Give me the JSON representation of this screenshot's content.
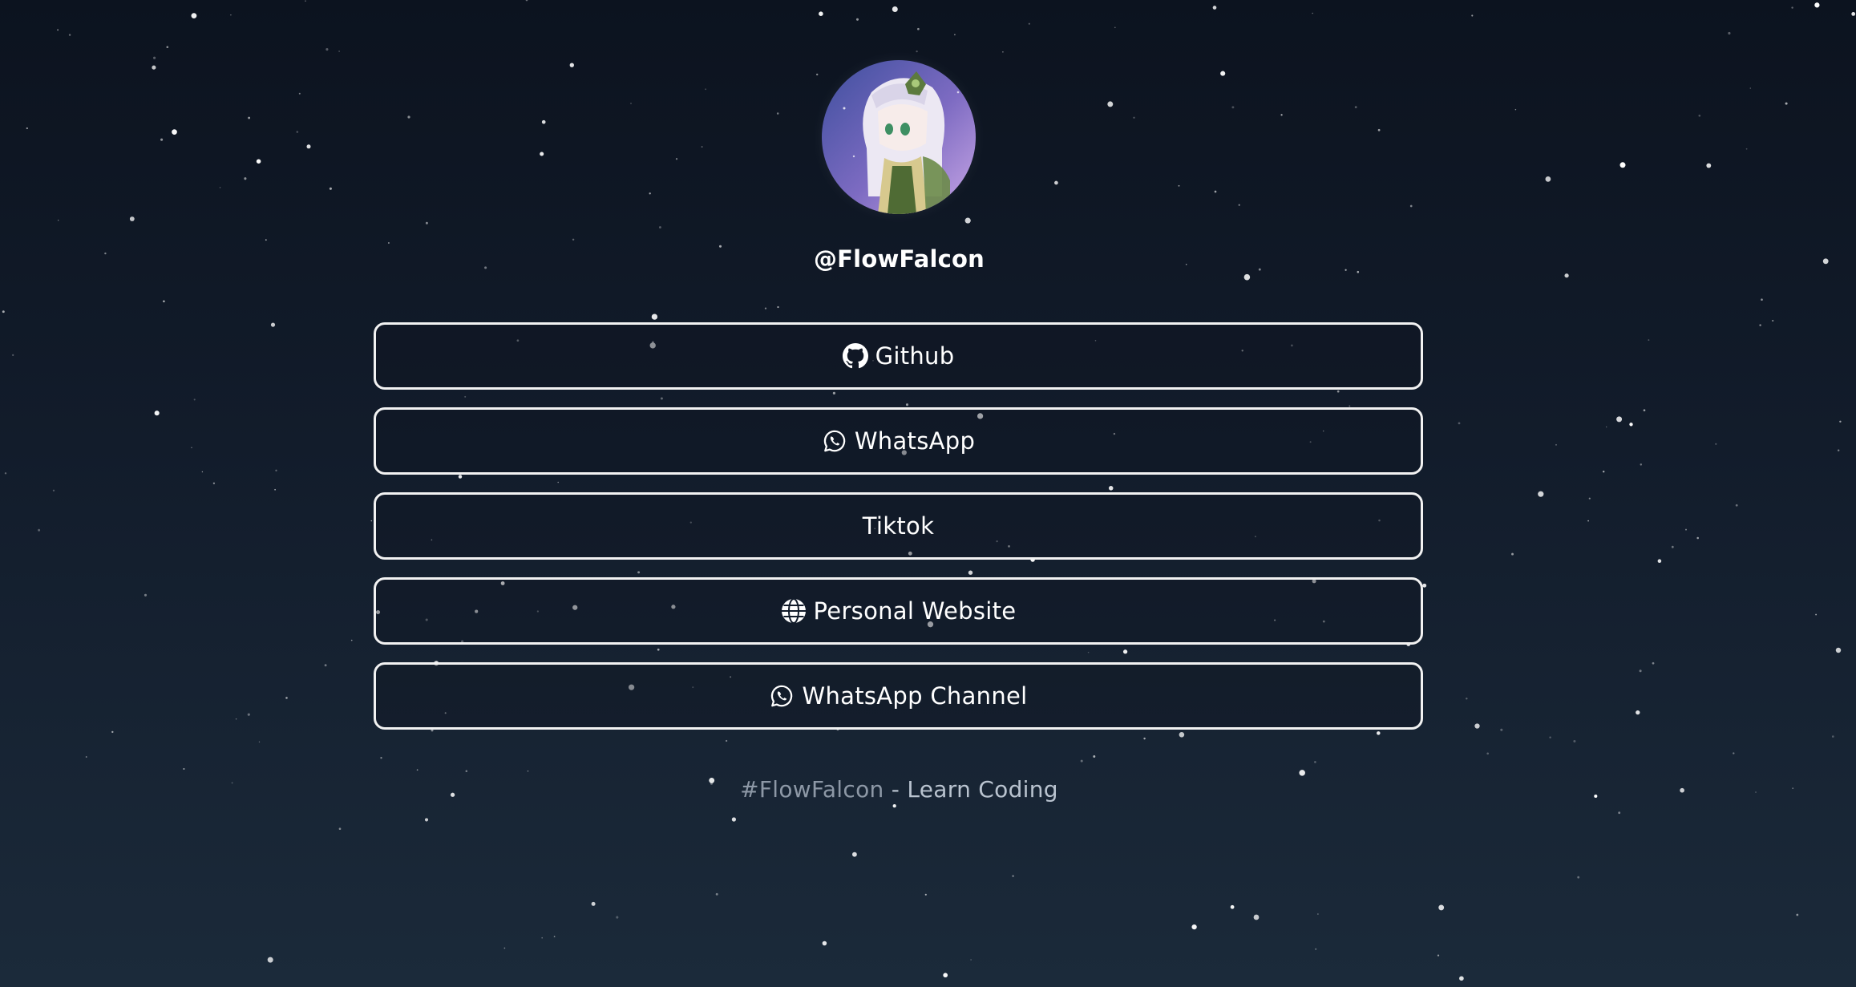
{
  "profile": {
    "username": "@FlowFalcon"
  },
  "links": [
    {
      "label": "Github",
      "icon": "github-icon"
    },
    {
      "label": "WhatsApp",
      "icon": "whatsapp-icon"
    },
    {
      "label": "Tiktok",
      "icon": ""
    },
    {
      "label": "Personal Website",
      "icon": "globe-icon"
    },
    {
      "label": "WhatsApp Channel",
      "icon": "whatsapp-icon"
    }
  ],
  "footer": {
    "hashtag": "#FlowFalcon",
    "text": " - Learn Coding"
  },
  "colors": {
    "background_top": "#0c131f",
    "background_bottom": "#1b2a3a",
    "button_border": "#f2f2f2",
    "footer_hashtag": "#8d98a6",
    "footer_text": "#b9c3cf"
  }
}
